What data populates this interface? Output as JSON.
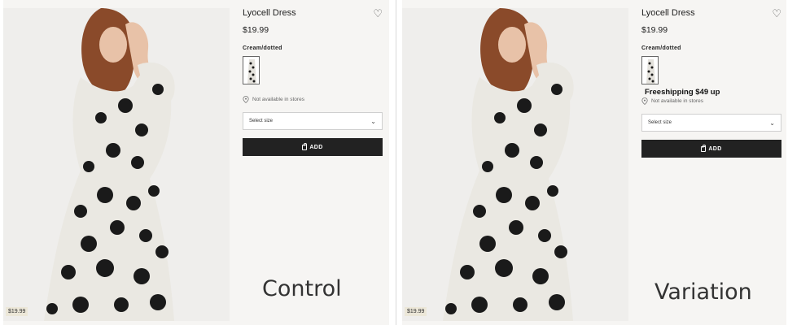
{
  "control": {
    "product_title": "Lyocell Dress",
    "price": "$19.99",
    "color_name": "Cream/dotted",
    "store_availability": "Not available in stores",
    "size_select_placeholder": "Select size",
    "add_button_label": "ADD",
    "image_price_tag": "$19.99",
    "label": "Control"
  },
  "variation": {
    "product_title": "Lyocell Dress",
    "price": "$19.99",
    "color_name": "Cream/dotted",
    "promo_text": "Freeshipping $49 up",
    "store_availability": "Not available in stores",
    "size_select_placeholder": "Select size",
    "add_button_label": "ADD",
    "image_price_tag": "$19.99",
    "label": "Variation"
  },
  "icons": {
    "wishlist": "heart-icon",
    "location": "map-pin-icon",
    "dropdown": "chevron-down-icon",
    "bag": "shopping-bag-icon"
  },
  "colors": {
    "background": "#f6f5f3",
    "button": "#222222",
    "dots": "#1a1a1a",
    "dress": "#eae8e2"
  }
}
